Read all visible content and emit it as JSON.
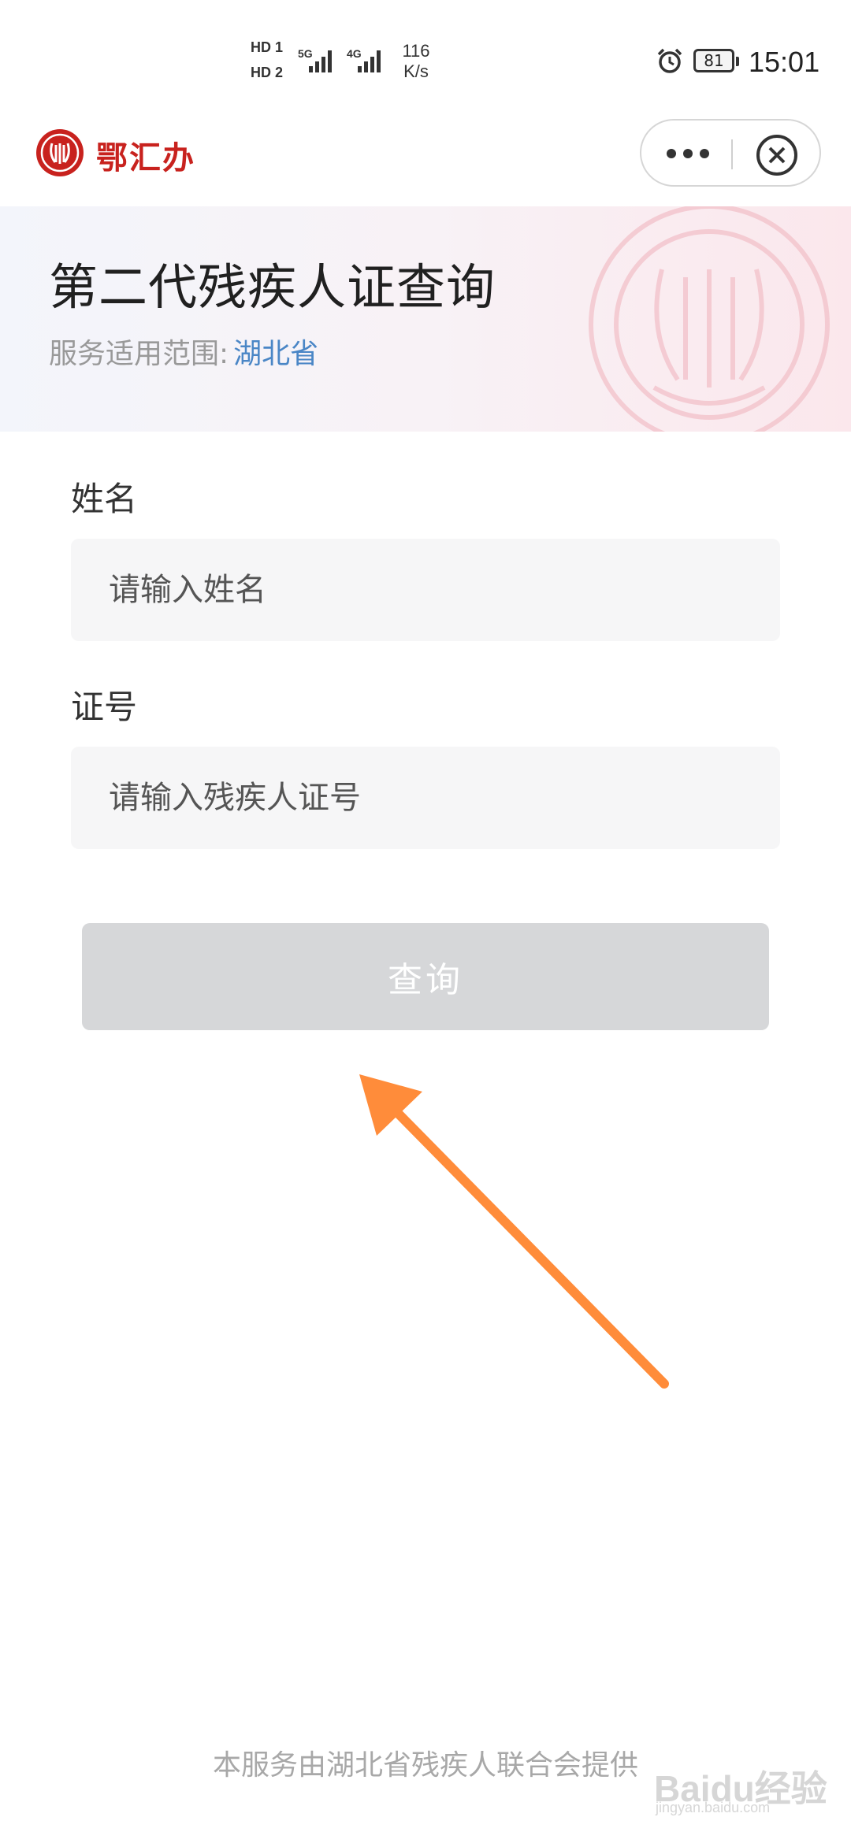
{
  "status_bar": {
    "sim1": "HD 1",
    "sim2": "HD 2",
    "net1": "5G",
    "net2": "4G",
    "speed_value": "116",
    "speed_unit": "K/s",
    "battery": "81",
    "time": "15:01"
  },
  "header": {
    "app_name": "鄂汇办"
  },
  "banner": {
    "title": "第二代残疾人证查询",
    "scope_label": "服务适用范围:",
    "scope_value": "湖北省"
  },
  "form": {
    "name_label": "姓名",
    "name_placeholder": "请输入姓名",
    "id_label": "证号",
    "id_placeholder": "请输入残疾人证号",
    "submit_label": "查询"
  },
  "footer": {
    "provider": "本服务由湖北省残疾人联合会提供"
  },
  "watermark": {
    "brand": "Baidu经验",
    "site": "jingyan.baidu.com"
  },
  "colors": {
    "brand_red": "#c8221e",
    "scope_blue": "#4a86c6",
    "button_disabled": "#d6d7d9",
    "arrow_orange": "#ff8c3a"
  }
}
